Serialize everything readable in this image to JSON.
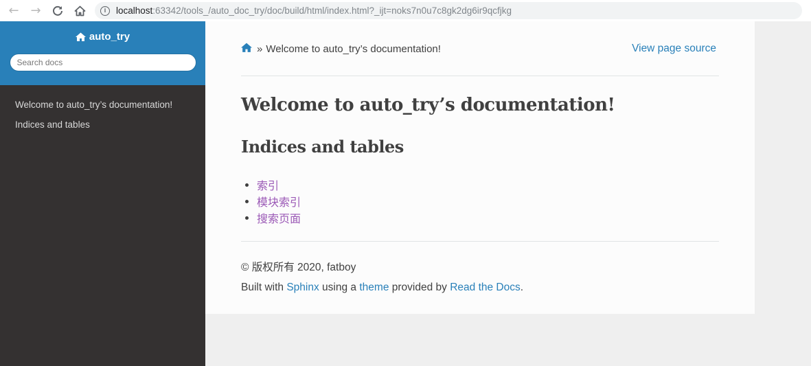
{
  "browser": {
    "url_host": "localhost",
    "url_rest": ":63342/tools_/auto_doc_try/doc/build/html/index.html?_ijt=noks7n0u7c8gk2dg6ir9qcfjkg",
    "info_glyph": "i"
  },
  "sidebar": {
    "project_name": "auto_try",
    "search_placeholder": "Search docs",
    "items": [
      {
        "label": "Welcome to auto_try’s documentation!"
      },
      {
        "label": "Indices and tables"
      }
    ]
  },
  "breadcrumbs": {
    "separator": "»",
    "current": "Welcome to auto_try’s documentation!",
    "view_source": "View page source"
  },
  "main": {
    "title": "Welcome to auto_try’s documentation!",
    "section_title": "Indices and tables",
    "index_links": [
      {
        "label": "索引"
      },
      {
        "label": "模块索引"
      },
      {
        "label": "搜索页面"
      }
    ]
  },
  "footer": {
    "copyright": "© 版权所有 2020, fatboy",
    "built_prefix": "Built with ",
    "sphinx": "Sphinx",
    "using_a": " using a ",
    "theme": "theme",
    "provided_by": " provided by ",
    "rtd": "Read the Docs",
    "period": "."
  },
  "colors": {
    "accent": "#2980b9",
    "sidebar_bg": "#343131",
    "visited_link": "#9b59b6"
  }
}
